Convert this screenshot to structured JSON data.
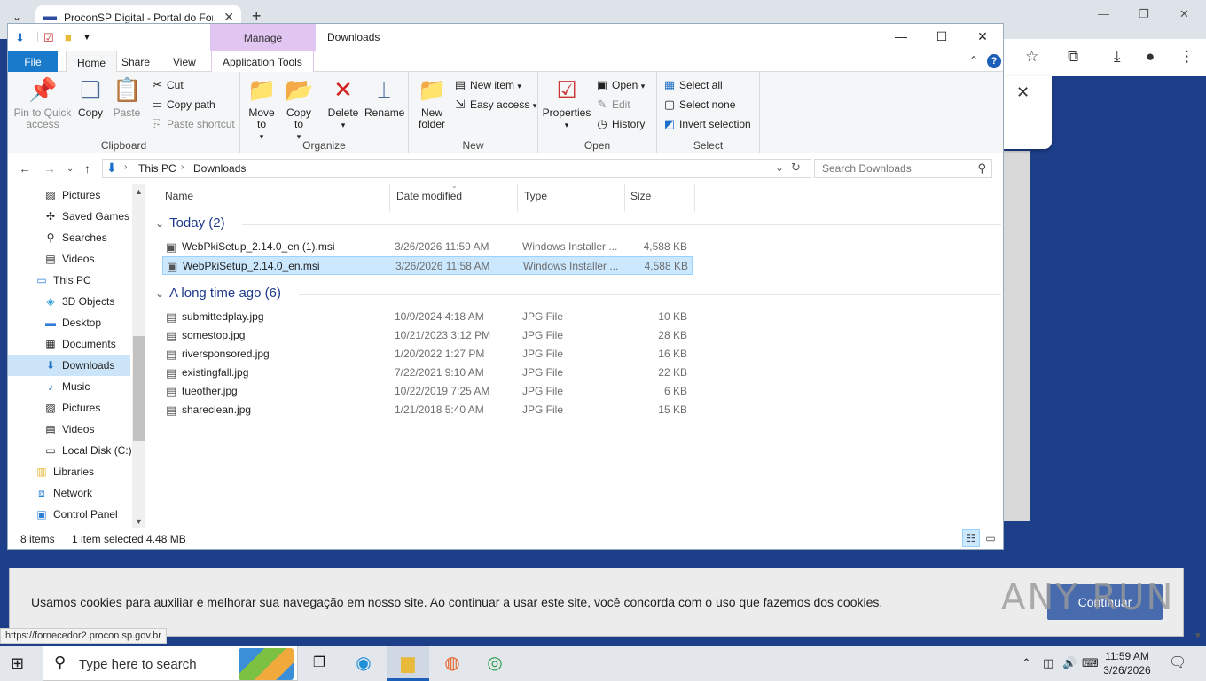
{
  "browser": {
    "tab_title": "ProconSP Digital - Portal do Fornecedor",
    "new_tab": "+",
    "close_tab": "✕",
    "status_url": "https://fornecedor2.procon.sp.gov.br"
  },
  "cookie": {
    "text": "Usamos cookies para auxiliar e melhorar sua navegação em nosso site. Ao continuar a usar este site, você concorda com o uso que fazemos dos cookies.",
    "button": "Continuar",
    "watermark": "ANY RUN"
  },
  "explorer": {
    "title": "Downloads",
    "context_tab_header": "Manage",
    "tabs": {
      "file": "File",
      "home": "Home",
      "share": "Share",
      "view": "View",
      "app_tools": "Application Tools"
    },
    "clipboard": {
      "label": "Clipboard",
      "pin": "Pin to Quick access",
      "copy": "Copy",
      "paste": "Paste",
      "cut": "Cut",
      "copy_path": "Copy path",
      "paste_shortcut": "Paste shortcut"
    },
    "organize": {
      "label": "Organize",
      "move_to": "Move to",
      "copy_to": "Copy to",
      "delete": "Delete",
      "rename": "Rename"
    },
    "new": {
      "label": "New",
      "new_folder": "New folder",
      "new_item": "New item",
      "easy_access": "Easy access"
    },
    "open": {
      "label": "Open",
      "properties": "Properties",
      "open": "Open",
      "edit": "Edit",
      "history": "History"
    },
    "select": {
      "label": "Select",
      "select_all": "Select all",
      "select_none": "Select none",
      "invert": "Invert selection"
    },
    "address": {
      "crumbs": [
        "This PC",
        "Downloads"
      ]
    },
    "search_placeholder": "Search Downloads",
    "nav_items": [
      {
        "label": "Pictures",
        "icon": "pictures-icon"
      },
      {
        "label": "Saved Games",
        "icon": "saved-games-icon"
      },
      {
        "label": "Searches",
        "icon": "searches-icon"
      },
      {
        "label": "Videos",
        "icon": "videos-icon"
      },
      {
        "label": "This PC",
        "icon": "this-pc-icon"
      },
      {
        "label": "3D Objects",
        "icon": "3d-objects-icon"
      },
      {
        "label": "Desktop",
        "icon": "desktop-icon"
      },
      {
        "label": "Documents",
        "icon": "documents-icon"
      },
      {
        "label": "Downloads",
        "icon": "downloads-icon"
      },
      {
        "label": "Music",
        "icon": "music-icon"
      },
      {
        "label": "Pictures",
        "icon": "pictures-icon"
      },
      {
        "label": "Videos",
        "icon": "videos-icon"
      },
      {
        "label": "Local Disk (C:)",
        "icon": "local-disk-icon"
      },
      {
        "label": "Libraries",
        "icon": "libraries-icon"
      },
      {
        "label": "Network",
        "icon": "network-icon"
      },
      {
        "label": "Control Panel",
        "icon": "control-panel-icon"
      }
    ],
    "columns": {
      "name": "Name",
      "date": "Date modified",
      "type": "Type",
      "size": "Size"
    },
    "groups": [
      {
        "header": "Today (2)",
        "files": [
          {
            "name": "WebPkiSetup_2.14.0_en (1).msi",
            "date": "3/26/2026 11:59 AM",
            "type": "Windows Installer ...",
            "size": "4,588 KB"
          },
          {
            "name": "WebPkiSetup_2.14.0_en.msi",
            "date": "3/26/2026 11:58 AM",
            "type": "Windows Installer ...",
            "size": "4,588 KB"
          }
        ]
      },
      {
        "header": "A long time ago (6)",
        "files": [
          {
            "name": "submittedplay.jpg",
            "date": "10/9/2024 4:18 AM",
            "type": "JPG File",
            "size": "10 KB"
          },
          {
            "name": "somestop.jpg",
            "date": "10/21/2023 3:12 PM",
            "type": "JPG File",
            "size": "28 KB"
          },
          {
            "name": "riversponsored.jpg",
            "date": "1/20/2022 1:27 PM",
            "type": "JPG File",
            "size": "16 KB"
          },
          {
            "name": "existingfall.jpg",
            "date": "7/22/2021 9:10 AM",
            "type": "JPG File",
            "size": "22 KB"
          },
          {
            "name": "tueother.jpg",
            "date": "10/22/2019 7:25 AM",
            "type": "JPG File",
            "size": "6 KB"
          },
          {
            "name": "shareclean.jpg",
            "date": "1/21/2018 5:40 AM",
            "type": "JPG File",
            "size": "15 KB"
          }
        ]
      }
    ],
    "status": {
      "items": "8 items",
      "selected": "1 item selected  4.48 MB"
    }
  },
  "taskbar": {
    "search_text": "Type here to search",
    "time": "11:59 AM",
    "date": "3/26/2026"
  },
  "colors": {
    "accent": "#1979ca",
    "page_bg": "#1d3f8a",
    "selection": "#cce8ff",
    "manage_tab": "#e2c6f2"
  }
}
